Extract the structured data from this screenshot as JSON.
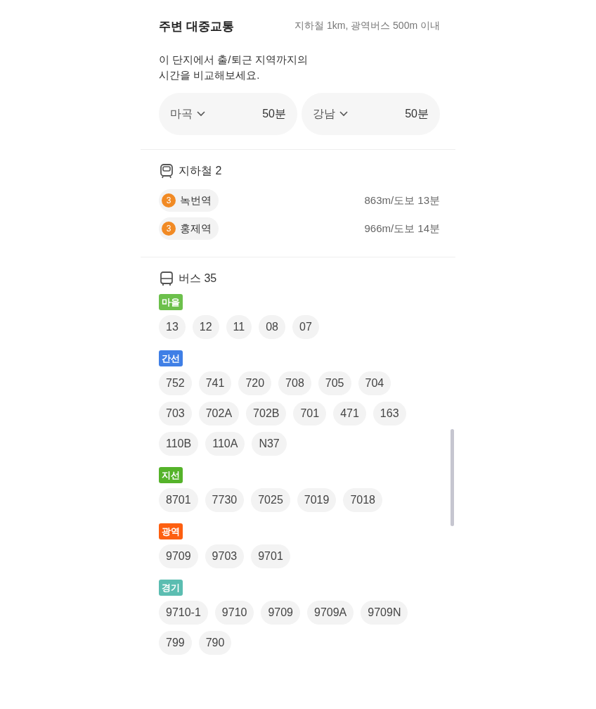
{
  "header": {
    "title": "주변 대중교통",
    "subtitle": "지하철 1km, 광역버스 500m 이내"
  },
  "commute": {
    "description": "이 단지에서 출/퇴근 지역까지의\n시간을 비교해보세요.",
    "options": [
      {
        "place": "마곡",
        "time": "50분"
      },
      {
        "place": "강남",
        "time": "50분"
      }
    ]
  },
  "subway": {
    "title": "지하철 2",
    "stations": [
      {
        "line": "3",
        "color": "#f18a24",
        "name": "녹번역",
        "distance": "863m/도보 13분"
      },
      {
        "line": "3",
        "color": "#f18a24",
        "name": "홍제역",
        "distance": "966m/도보 14분"
      }
    ]
  },
  "bus": {
    "title": "버스 35",
    "groups": [
      {
        "type": "마을",
        "color": "#6cc04b",
        "routes": [
          "13",
          "12",
          "11",
          "08",
          "07"
        ]
      },
      {
        "type": "간선",
        "color": "#3f7fe6",
        "routes": [
          "752",
          "741",
          "720",
          "708",
          "705",
          "704",
          "703",
          "702A",
          "702B",
          "701",
          "471",
          "163",
          "110B",
          "110A",
          "N37"
        ]
      },
      {
        "type": "지선",
        "color": "#55b32a",
        "routes": [
          "8701",
          "7730",
          "7025",
          "7019",
          "7018"
        ]
      },
      {
        "type": "광역",
        "color": "#fd5f10",
        "routes": [
          "9709",
          "9703",
          "9701"
        ]
      },
      {
        "type": "경기",
        "color": "#5bbdb1",
        "routes": [
          "9710-1",
          "9710",
          "9709",
          "9709A",
          "9709N",
          "799",
          "790"
        ]
      }
    ]
  }
}
